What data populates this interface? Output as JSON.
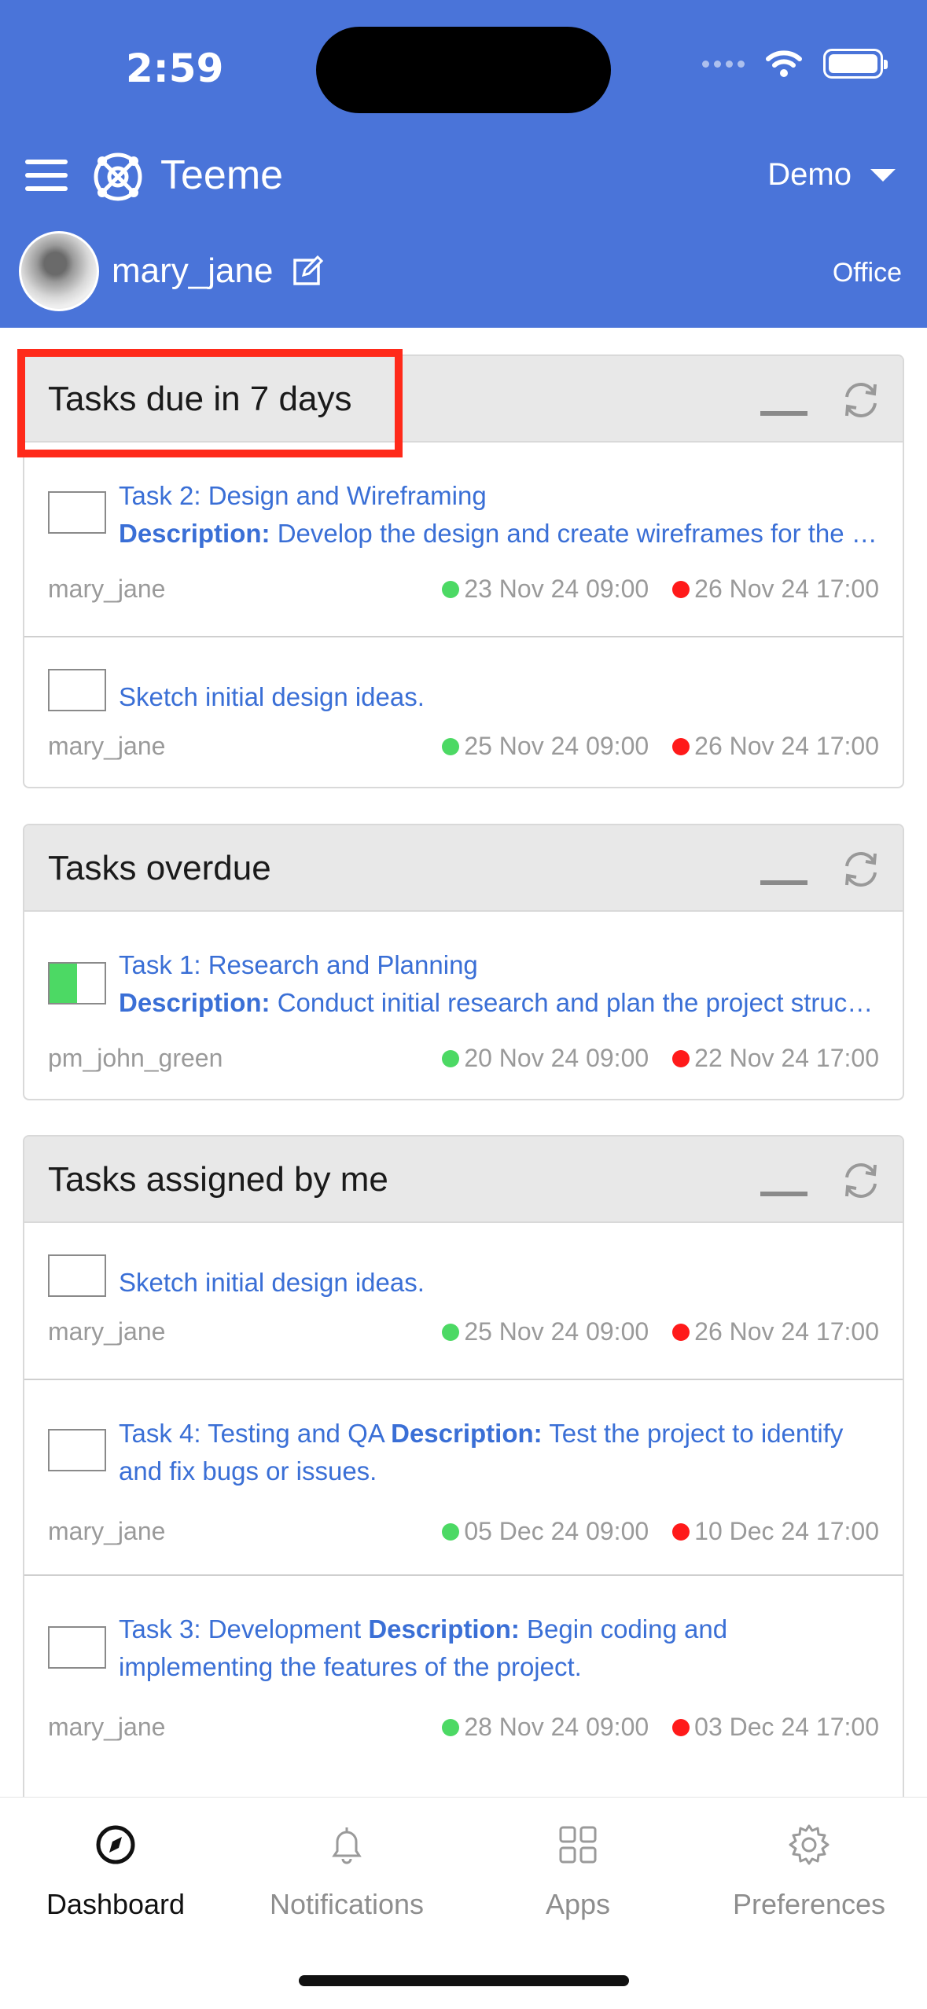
{
  "status_bar": {
    "time": "2:59"
  },
  "header": {
    "app_title": "Teeme",
    "workspace": "Demo",
    "username": "mary_jane",
    "location": "Office"
  },
  "cards": [
    {
      "title": "Tasks due in 7 days",
      "rows": [
        {
          "title": "Task 2: Design and Wireframing",
          "desc_label": "Description:",
          "desc": "Develop the design and create wireframes for the project.",
          "user": "mary_jane",
          "start": "23 Nov 24 09:00",
          "end": "26 Nov 24 17:00"
        },
        {
          "title": "Sketch initial design ideas.",
          "user": "mary_jane",
          "start": "25 Nov 24 09:00",
          "end": "26 Nov 24 17:00"
        }
      ]
    },
    {
      "title": "Tasks overdue",
      "rows": [
        {
          "title": "Task 1: Research and Planning",
          "desc_label": "Description:",
          "desc": "Conduct initial research and plan the project structure.",
          "user": "pm_john_green",
          "start": "20 Nov 24 09:00",
          "end": "22 Nov 24 17:00",
          "progress": 0.5
        }
      ]
    },
    {
      "title": "Tasks assigned by me",
      "rows": [
        {
          "title": "Sketch initial design ideas.",
          "user": "mary_jane",
          "start": "25 Nov 24 09:00",
          "end": "26 Nov 24 17:00"
        },
        {
          "title": "Task 4: Testing and QA",
          "desc_label": "Description:",
          "desc": "Test the project to identify and fix bugs or issues.",
          "user": "mary_jane",
          "start": "05 Dec 24 09:00",
          "end": "10 Dec 24 17:00"
        },
        {
          "title": "Task 3: Development",
          "desc_label": "Description:",
          "desc": "Begin coding and implementing the features of the project.",
          "user": "mary_jane",
          "start": "28 Nov 24 09:00",
          "end": "03 Dec 24 17:00"
        }
      ]
    }
  ],
  "tabs": [
    {
      "label": "Dashboard",
      "icon": "compass-icon",
      "active": true
    },
    {
      "label": "Notifications",
      "icon": "bell-icon"
    },
    {
      "label": "Apps",
      "icon": "grid-icon"
    },
    {
      "label": "Preferences",
      "icon": "gear-icon"
    }
  ],
  "colors": {
    "header": "#4a74d9",
    "link": "#3a6fd6",
    "start_dot": "#4cd964",
    "end_dot": "#ff1a1a",
    "highlight": "#ff2a1a"
  }
}
